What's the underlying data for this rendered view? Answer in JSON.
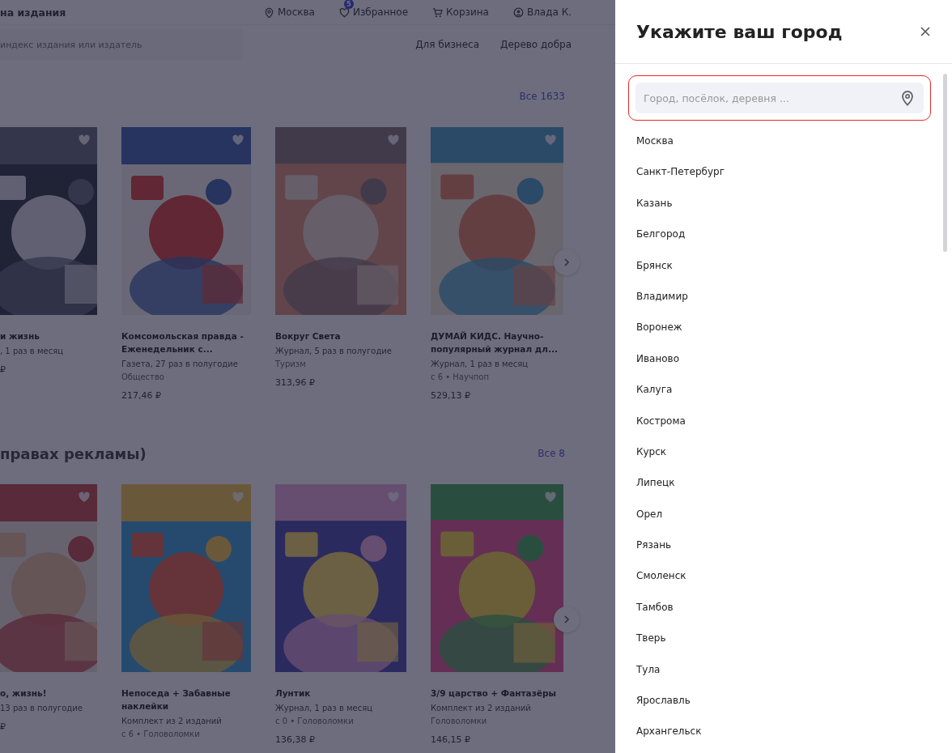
{
  "header": {
    "logo_text": "на издания",
    "nav": [
      {
        "kind": "pin",
        "label": "Москва"
      },
      {
        "kind": "heart",
        "label": "Избранное",
        "badge": "5"
      },
      {
        "kind": "cart",
        "label": "Корзина"
      },
      {
        "kind": "user",
        "label": "Влада К."
      }
    ],
    "search": {
      "placeholder": "индекс издания или издатель"
    },
    "links": [
      "Для бизнеса",
      "Дерево добра"
    ]
  },
  "sections": [
    {
      "all_link": "Все 1633",
      "cards": [
        {
          "title": "и жизнь",
          "info": ", 1 раз в месяц",
          "price": "₽"
        },
        {
          "title": "Комсомольская правда - Еженедельник с...",
          "info": "Газета, 27 раз в полугодие",
          "category": "Общество",
          "price": "217,46 ₽"
        },
        {
          "title": "Вокруг Света",
          "info": "Журнал, 5 раз в полугодие",
          "category": "Туризм",
          "price": "313,96 ₽"
        },
        {
          "title": "ДУМАЙ КИДС. Научно-популярный журнал дл...",
          "info": "Журнал, 1 раз в месяц",
          "category": "с 6 • Научпоп",
          "price": "529,13 ₽"
        }
      ]
    },
    {
      "title": "правах рекламы)",
      "all_link": "Все 8",
      "cards": [
        {
          "title": "о, жизнь!",
          "info": "13 раз в полугодие",
          "price": "₽"
        },
        {
          "title": "Непоседа + Забавные наклейки",
          "info": "Комплект из 2 изданий",
          "category": "с 6 • Головоломки"
        },
        {
          "title": "Лунтик",
          "info": "Журнал, 1 раз в месяц",
          "category": "с 0 • Головоломки",
          "price": "136,38 ₽"
        },
        {
          "title": "3/9 царство + Фантазёры",
          "info": "Комплект из 2 изданий",
          "category": "Головоломки",
          "price": "146,15 ₽"
        }
      ]
    }
  ],
  "city_panel": {
    "title": "Укажите ваш город",
    "search": {
      "placeholder": "Город, посёлок, деревня ..."
    },
    "cities": [
      "Москва",
      "Санкт-Петербург",
      "Казань",
      "Белгород",
      "Брянск",
      "Владимир",
      "Воронеж",
      "Иваново",
      "Калуга",
      "Кострома",
      "Курск",
      "Липецк",
      "Орел",
      "Рязань",
      "Смоленск",
      "Тамбов",
      "Тверь",
      "Тула",
      "Ярославль",
      "Архангельск"
    ]
  }
}
